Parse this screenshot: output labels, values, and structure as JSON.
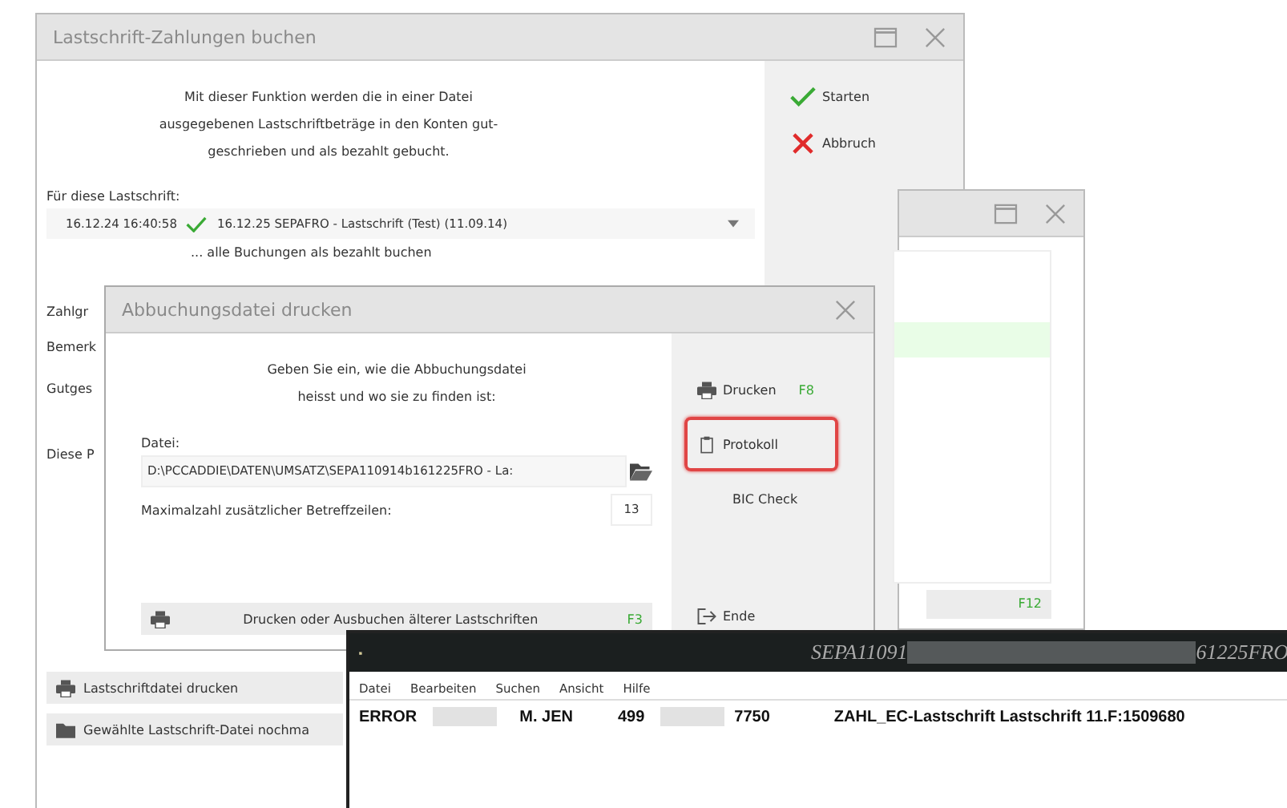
{
  "main_window": {
    "title": "Lastschrift-Zahlungen buchen",
    "description": "Mit dieser Funktion werden die in einer Datei\nausgegebenen Lastschriftbeträge in den Konten gut-\ngeschrieben und als bezahlt gebucht.",
    "selection_label": "Für diese Lastschrift:",
    "selection": {
      "timestamp": "16.12.24  16:40:58",
      "entry": "16.12.25  SEPAFRO - Lastschrift (Test) (11.09.14)"
    },
    "selection_note": "... alle Buchungen als bezahlt buchen",
    "field_labels": [
      "Zahlgr",
      "Bemerk",
      "Gutges",
      "Diese P"
    ],
    "actions": [
      {
        "label": "Starten",
        "kind": "confirm"
      },
      {
        "label": "Abbruch",
        "kind": "cancel"
      }
    ],
    "bottom_buttons": [
      {
        "label": "Lastschriftdatei drucken",
        "kind": "print"
      },
      {
        "label": "Gewählte Lastschrift-Datei nochma",
        "kind": "reopen"
      }
    ]
  },
  "back_window": {
    "shortcut": "F12"
  },
  "dialog": {
    "title": "Abbuchungsdatei drucken",
    "instructions": "Geben Sie ein, wie die Abbuchungsdatei\nheisst und wo sie zu finden ist:",
    "file_label": "Datei:",
    "file_value": "D:\\PCCADDIE\\DATEN\\UMSATZ\\SEPA110914b161225FRO - La:",
    "max_label": "Maximalzahl zusätzlicher Betreffzeilen:",
    "max_value": "13",
    "older_button": {
      "label": "Drucken oder Ausbuchen älterer Lastschriften",
      "shortcut": "F3"
    },
    "actions": [
      {
        "label": "Drucken",
        "kind": "print",
        "shortcut": "F8",
        "highlighted": false
      },
      {
        "label": "Protokoll",
        "kind": "log",
        "highlighted": true
      },
      {
        "label": "BIC Check",
        "kind": "check",
        "highlighted": false
      },
      {
        "label": "Ende",
        "kind": "exit",
        "highlighted": false
      }
    ]
  },
  "notepad": {
    "title": [
      {
        "kind": "text",
        "text": "SEPA11091"
      },
      {
        "kind": "redacted"
      },
      {
        "kind": "text",
        "text": "61225FRO"
      }
    ],
    "menu": [
      "Datei",
      "Bearbeiten",
      "Suchen",
      "Ansicht",
      "Hilfe"
    ],
    "line": [
      {
        "kind": "text",
        "text": "ERROR"
      },
      {
        "kind": "redacted"
      },
      {
        "kind": "text",
        "text": "M. JEN"
      },
      {
        "kind": "text",
        "text": "499"
      },
      {
        "kind": "redacted"
      },
      {
        "kind": "text",
        "text": "7750"
      },
      {
        "kind": "text",
        "text": "ZAHL_EC-Lastschrift Lastschrift 11.F:1509680"
      }
    ]
  }
}
